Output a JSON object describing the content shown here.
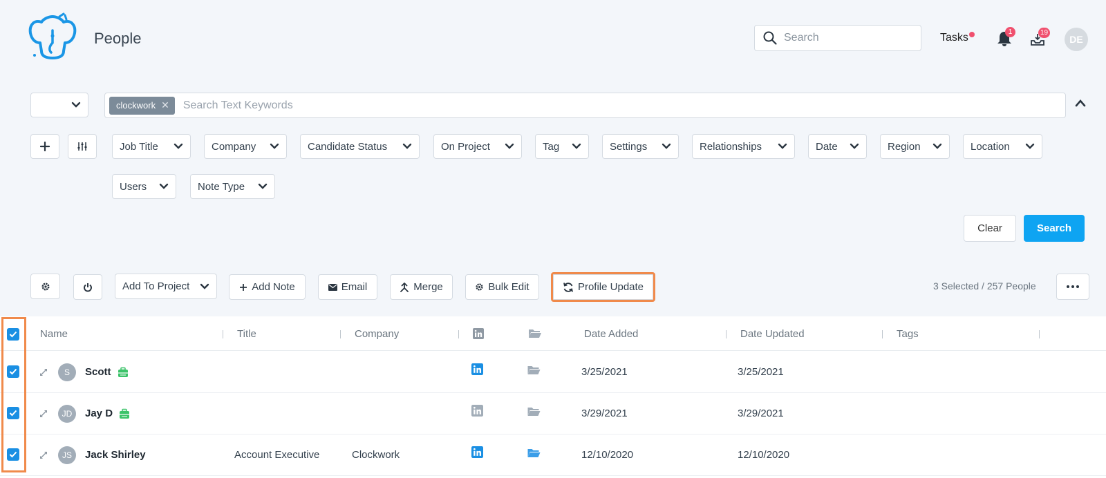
{
  "header": {
    "title": "People",
    "search_placeholder": "Search",
    "tasks_label": "Tasks",
    "notifications_count": "1",
    "inbox_count": "19",
    "user_initials": "DE"
  },
  "filters": {
    "keyword_chip": "clockwork",
    "keyword_placeholder": "Search Text Keywords",
    "dropdowns": [
      "Job Title",
      "Company",
      "Candidate Status",
      "On Project",
      "Tag",
      "Settings",
      "Relationships",
      "Date",
      "Region",
      "Location",
      "Users",
      "Note Type"
    ],
    "clear_label": "Clear",
    "search_label": "Search"
  },
  "actions": {
    "add_to_project": "Add To Project",
    "add_note": "Add Note",
    "email": "Email",
    "merge": "Merge",
    "bulk_edit": "Bulk Edit",
    "profile_update": "Profile Update",
    "selection_summary": "3 Selected / 257 People"
  },
  "table": {
    "columns": [
      "Name",
      "Title",
      "Company",
      "Date Added",
      "Date Updated",
      "Tags"
    ],
    "rows": [
      {
        "initials": "S",
        "name": "Scott",
        "title": "",
        "company": "",
        "date_added": "3/25/2021",
        "date_updated": "3/25/2021",
        "linkedin_active": true,
        "folder_active": false,
        "has_status_icon": true
      },
      {
        "initials": "JD",
        "name": "Jay D",
        "title": "",
        "company": "",
        "date_added": "3/29/2021",
        "date_updated": "3/29/2021",
        "linkedin_active": false,
        "folder_active": false,
        "has_status_icon": true
      },
      {
        "initials": "JS",
        "name": "Jack Shirley",
        "title": "Account Executive",
        "company": "Clockwork",
        "date_added": "12/10/2020",
        "date_updated": "12/10/2020",
        "linkedin_active": true,
        "folder_active": true,
        "has_status_icon": false
      }
    ]
  },
  "colors": {
    "accent": "#0ea4f2",
    "highlight": "#f08a4b",
    "badge": "#f0506e",
    "linkedin": "#1a8fe3",
    "status_green": "#3cc36a"
  }
}
